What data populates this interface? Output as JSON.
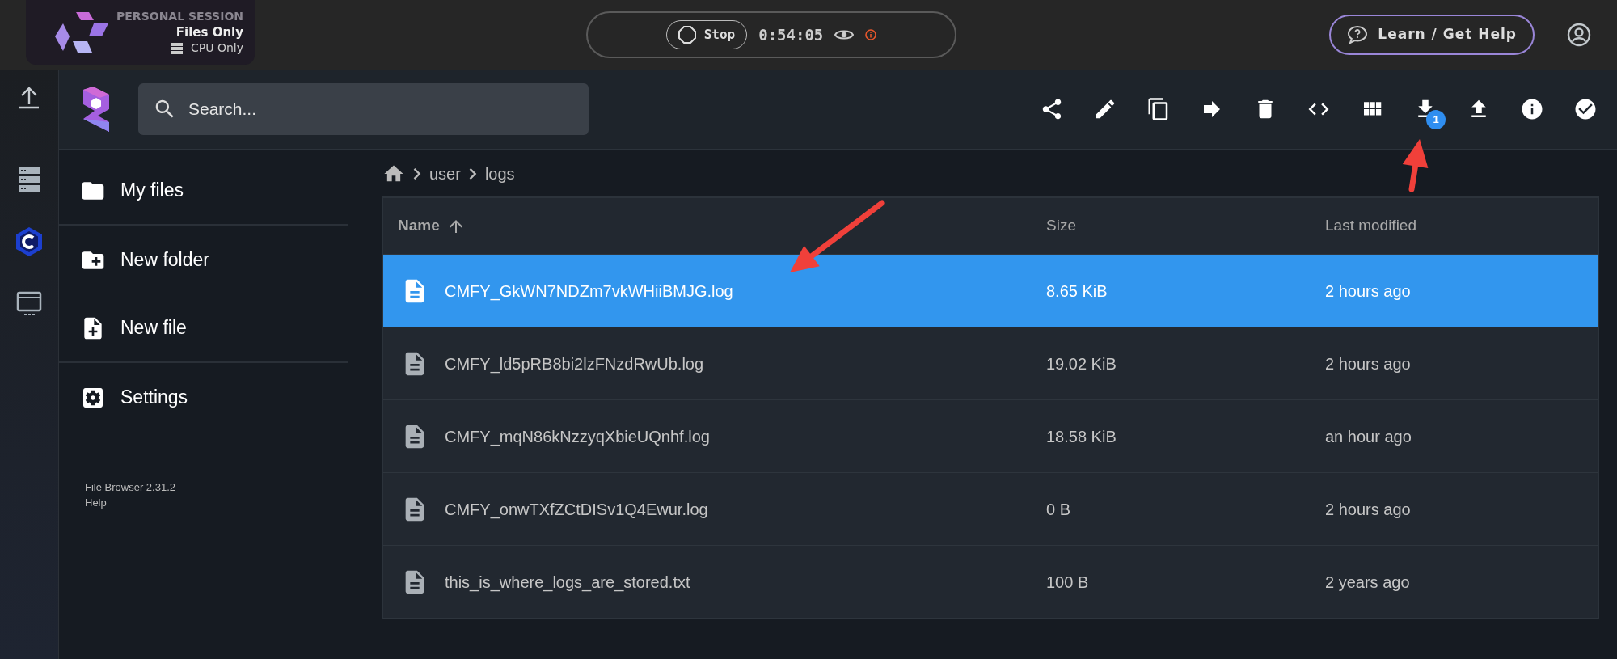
{
  "top_bar": {
    "session": {
      "label": "PERSONAL SESSION",
      "mode": "Files Only",
      "resource": "CPU Only"
    },
    "stop_button": "Stop",
    "timer": "0:54:05",
    "help_button": "Learn / Get Help"
  },
  "rail": [
    {
      "kind": "upload"
    },
    {
      "kind": "server"
    },
    {
      "kind": "c-badge"
    },
    {
      "kind": "monitor"
    }
  ],
  "search": {
    "placeholder": "Search..."
  },
  "toolbar": [
    {
      "kind": "share"
    },
    {
      "kind": "edit"
    },
    {
      "kind": "copy"
    },
    {
      "kind": "move"
    },
    {
      "kind": "delete"
    },
    {
      "kind": "code"
    },
    {
      "kind": "grid"
    },
    {
      "kind": "download",
      "badge": "1",
      "pointed_at": true
    },
    {
      "kind": "upload"
    },
    {
      "kind": "info"
    },
    {
      "kind": "check"
    }
  ],
  "sidebar": {
    "items": [
      {
        "kind": "folder",
        "label": "My files"
      },
      {
        "kind": "new-folder",
        "label": "New folder"
      },
      {
        "kind": "new-file",
        "label": "New file"
      },
      {
        "kind": "settings",
        "label": "Settings"
      }
    ],
    "footer": [
      "File Browser 2.31.2",
      "Help"
    ]
  },
  "breadcrumb": [
    "user",
    "logs"
  ],
  "table": {
    "columns": [
      {
        "label": "Name",
        "sorted": true
      },
      {
        "label": "Size",
        "sorted": false
      },
      {
        "label": "Last modified",
        "sorted": false
      }
    ],
    "rows": [
      {
        "name": "CMFY_GkWN7NDZm7vkWHiiBMJG.log",
        "size": "8.65 KiB",
        "modified": "2 hours ago",
        "selected": true,
        "pointed_at": true
      },
      {
        "name": "CMFY_ld5pRB8bi2lzFNzdRwUb.log",
        "size": "19.02 KiB",
        "modified": "2 hours ago",
        "selected": false,
        "pointed_at": false
      },
      {
        "name": "CMFY_mqN86kNzzyqXbieUQnhf.log",
        "size": "18.58 KiB",
        "modified": "an hour ago",
        "selected": false,
        "pointed_at": false
      },
      {
        "name": "CMFY_onwTXfZCtDISv1Q4Ewur.log",
        "size": "0 B",
        "modified": "2 hours ago",
        "selected": false,
        "pointed_at": false
      },
      {
        "name": "this_is_where_logs_are_stored.txt",
        "size": "100 B",
        "modified": "2 years ago",
        "selected": false,
        "pointed_at": false
      }
    ]
  }
}
